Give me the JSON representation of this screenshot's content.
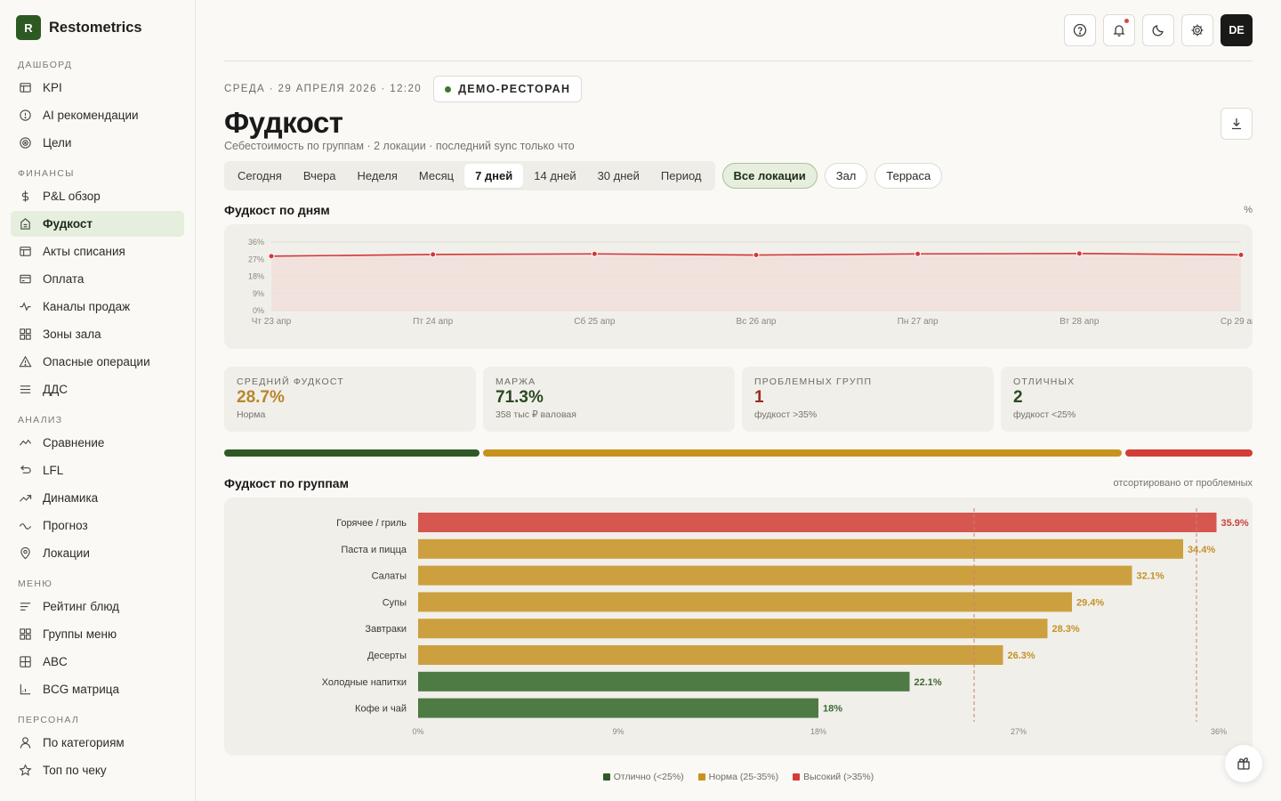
{
  "brand": {
    "logo_letter": "R",
    "name": "Restometrics"
  },
  "sidebar": {
    "sections": [
      {
        "heading": "ДАШБОРД",
        "items": [
          {
            "label": "KPI",
            "icon": "table-icon"
          },
          {
            "label": "AI рекомендации",
            "icon": "alert-circle-icon"
          },
          {
            "label": "Цели",
            "icon": "target-icon"
          }
        ]
      },
      {
        "heading": "ФИНАНСЫ",
        "items": [
          {
            "label": "P&L обзор",
            "icon": "dollar-icon"
          },
          {
            "label": "Фудкост",
            "icon": "cost-icon",
            "active": true
          },
          {
            "label": "Акты списания",
            "icon": "table-icon"
          },
          {
            "label": "Оплата",
            "icon": "card-icon"
          },
          {
            "label": "Каналы продаж",
            "icon": "activity-icon"
          },
          {
            "label": "Зоны зала",
            "icon": "grid-icon"
          },
          {
            "label": "Опасные операции",
            "icon": "warning-icon"
          },
          {
            "label": "ДДС",
            "icon": "menu-lines-icon"
          }
        ]
      },
      {
        "heading": "АНАЛИЗ",
        "items": [
          {
            "label": "Сравнение",
            "icon": "compare-icon"
          },
          {
            "label": "LFL",
            "icon": "lfl-icon"
          },
          {
            "label": "Динамика",
            "icon": "trend-up-icon"
          },
          {
            "label": "Прогноз",
            "icon": "wave-icon"
          },
          {
            "label": "Локации",
            "icon": "map-pin-icon"
          }
        ]
      },
      {
        "heading": "МЕНЮ",
        "items": [
          {
            "label": "Рейтинг блюд",
            "icon": "list-icon"
          },
          {
            "label": "Группы меню",
            "icon": "grid-icon"
          },
          {
            "label": "ABC",
            "icon": "abc-grid-icon"
          },
          {
            "label": "BCG матрица",
            "icon": "axis-icon"
          }
        ]
      },
      {
        "heading": "ПЕРСОНАЛ",
        "items": [
          {
            "label": "По категориям",
            "icon": "user-icon"
          },
          {
            "label": "Топ по чеку",
            "icon": "star-icon"
          }
        ]
      }
    ]
  },
  "header": {
    "avatar": "DE",
    "date": "СРЕДА · 29 АПРЕЛЯ 2026 · 12:20",
    "demo_badge": "ДЕМО-РЕСТОРАН",
    "title": "Фудкост",
    "subtitle": "Себестоимость по группам · 2 локации · последний sync только что"
  },
  "filters": {
    "periods": [
      "Сегодня",
      "Вчера",
      "Неделя",
      "Месяц",
      "7 дней",
      "14 дней",
      "30 дней",
      "Период"
    ],
    "active_period": "7 дней",
    "locations": [
      "Все локации",
      "Зал",
      "Терраса"
    ],
    "active_location": "Все локации"
  },
  "line_section": {
    "title": "Фудкост по дням",
    "note": "%"
  },
  "kpis": [
    {
      "label": "СРЕДНИЙ ФУДКОСТ",
      "value": "28.7%",
      "sub": "Норма",
      "color": "#b8862a"
    },
    {
      "label": "МАРЖА",
      "value": "71.3%",
      "sub": "358 тыс ₽ валовая",
      "color": "#2a4a1f"
    },
    {
      "label": "ПРОБЛЕМНЫХ ГРУПП",
      "value": "1",
      "sub": "фудкост >35%",
      "color": "#9a2a22"
    },
    {
      "label": "ОТЛИЧНЫХ",
      "value": "2",
      "sub": "фудкост <25%",
      "color": "#2a4a1f"
    }
  ],
  "distribution": [
    {
      "share": 2,
      "color": "#2f5a25"
    },
    {
      "share": 5,
      "color": "#c8921e"
    },
    {
      "share": 1,
      "color": "#d43c36"
    }
  ],
  "bar_section": {
    "title": "Фудкост по группам",
    "note": "отсортировано от проблемных"
  },
  "legend": [
    {
      "label": "Отлично (<25%)",
      "color": "#2f5a25"
    },
    {
      "label": "Норма (25-35%)",
      "color": "#c8921e"
    },
    {
      "label": "Высокий (>35%)",
      "color": "#d43c36"
    }
  ],
  "colors": {
    "accent": "#2d5a23",
    "good": "#4e7a44",
    "norm": "#cca03f",
    "high": "#d6574f",
    "line": "#d0383a"
  },
  "chart_data": [
    {
      "type": "line",
      "title": "Фудкост по дням",
      "x": [
        "Чт 23 апр",
        "Пт 24 апр",
        "Сб 25 апр",
        "Вс 26 апр",
        "Пн 27 апр",
        "Вт 28 апр",
        "Ср 29 апр"
      ],
      "series": [
        {
          "values": [
            28.6,
            29.5,
            29.8,
            29.2,
            29.8,
            30.0,
            29.3
          ]
        }
      ],
      "yticks": [
        "0%",
        "9%",
        "18%",
        "27%",
        "36%"
      ],
      "ylim": [
        0,
        36
      ],
      "grid": true
    },
    {
      "type": "bar",
      "orientation": "horizontal",
      "title": "Фудкост по группам",
      "categories": [
        "Горячее / гриль",
        "Паста и пицца",
        "Салаты",
        "Супы",
        "Завтраки",
        "Десерты",
        "Холодные напитки",
        "Кофе и чай"
      ],
      "values": [
        35.9,
        34.4,
        32.1,
        29.4,
        28.3,
        26.3,
        22.1,
        18.0
      ],
      "value_labels": [
        "35.9%",
        "34.4%",
        "32.1%",
        "29.4%",
        "28.3%",
        "26.3%",
        "22.1%",
        "18%"
      ],
      "xticks": [
        "0%",
        "9%",
        "18%",
        "27%",
        "36%"
      ],
      "xlim": [
        0,
        36
      ],
      "thresholds": [
        25,
        35
      ]
    }
  ]
}
